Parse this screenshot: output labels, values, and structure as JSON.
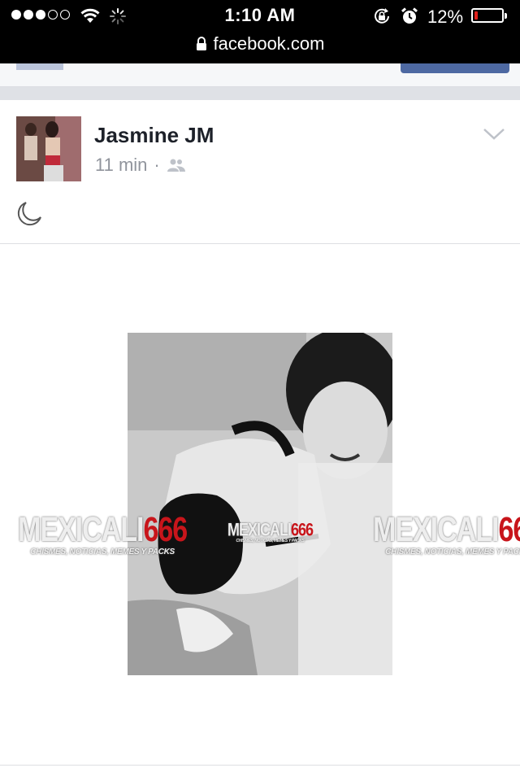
{
  "status_bar": {
    "signal_filled": 3,
    "signal_total": 5,
    "time": "1:10 AM",
    "url": "facebook.com",
    "battery_percent": "12%",
    "battery_level": 0.12,
    "battery_color": "#e0201b",
    "icons": [
      "wifi-icon",
      "loading-spinner-icon",
      "rotation-lock-icon",
      "alarm-icon",
      "lock-icon",
      "battery-icon"
    ]
  },
  "post": {
    "author": "Jasmine JM",
    "time": "11 min",
    "separator": "·",
    "audience_icon": "friends-icon",
    "menu_icon": "chevron-down-icon",
    "content_icon": "moon-icon",
    "watermark": {
      "brand_part1": "MEXICALI",
      "brand_part2": "666",
      "tagline": "CHISMES, NOTICIAS, MEMES Y PACKS",
      "brand_color": "#c8151b"
    }
  }
}
